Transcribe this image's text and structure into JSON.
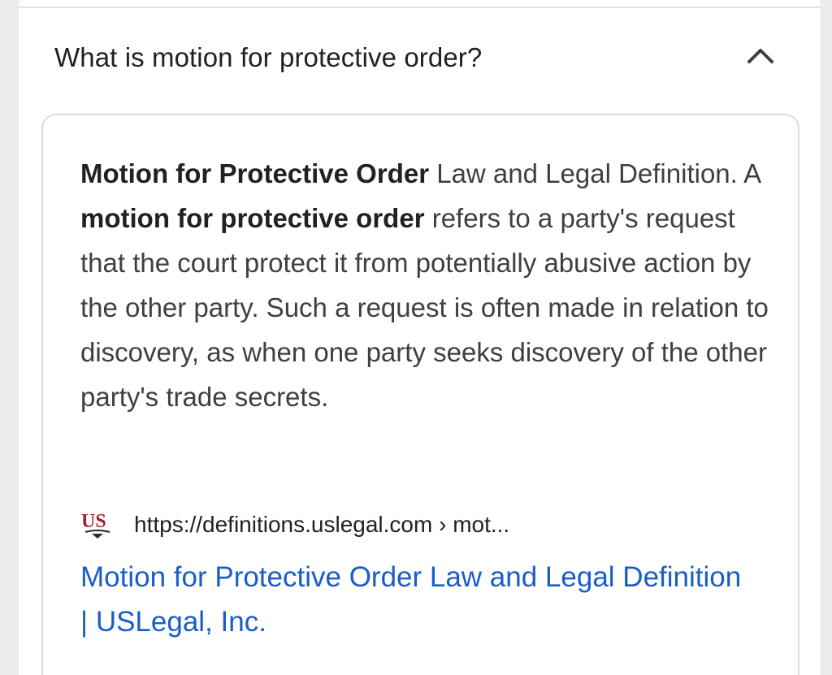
{
  "faq": {
    "question": "What is motion for protective order?",
    "expanded": true
  },
  "answer": {
    "snippet_parts": [
      {
        "text": "Motion for Protective Order",
        "bold": true
      },
      {
        "text": " Law and Legal Definition. A ",
        "bold": false
      },
      {
        "text": "motion for protective order",
        "bold": true
      },
      {
        "text": " refers to a party's request that the court protect it from potentially abusive action by the other party. Such a request is often made in relation to discovery, as when one party seeks discovery of the other party's trade secrets.",
        "bold": false
      }
    ],
    "source": {
      "logo_text": "US",
      "url": "https://definitions.uslegal.com › mot..."
    },
    "link_title": "Motion for Protective Order Law and Legal Definition | USLegal, Inc."
  },
  "colors": {
    "link": "#1a5dc8",
    "text": "#3c4043",
    "logo": "#a3232a"
  }
}
